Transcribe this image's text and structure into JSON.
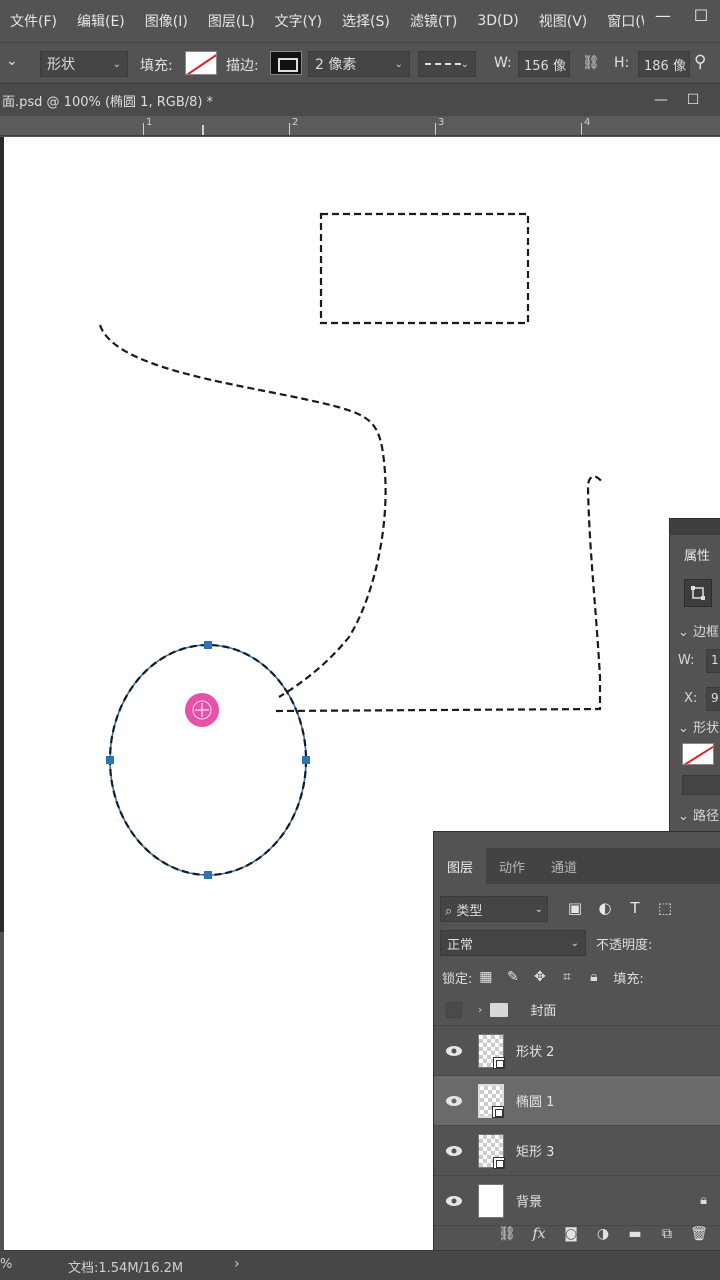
{
  "menubar": {
    "items": [
      "文件(F)",
      "编辑(E)",
      "图像(I)",
      "图层(L)",
      "文字(Y)",
      "选择(S)",
      "滤镜(T)",
      "3D(D)",
      "视图(V)",
      "窗口(W"
    ],
    "window_buttons": [
      "—",
      "☐"
    ]
  },
  "options": {
    "left_chevron": "⌄",
    "mode": "形状",
    "fill_label": "填充:",
    "stroke_label": "描边:",
    "stroke_width": "2 像素",
    "w_label": "W:",
    "w_value": "156 像",
    "h_label": "H:",
    "h_value": "186 像",
    "search_glyph": "⚲"
  },
  "document": {
    "tab_title": "面.psd @ 100% (椭圆 1, RGB/8) *",
    "buttons": [
      "—",
      "☐",
      "✕"
    ]
  },
  "ruler": {
    "labels": [
      "1",
      "2",
      "3",
      "4"
    ]
  },
  "properties": {
    "title": "属性",
    "section1": "边框",
    "w_label": "W:",
    "w_value": "1!",
    "x_label": "X:",
    "x_value": "9:",
    "section2": "形状",
    "section3": "路径"
  },
  "layers": {
    "tabs": [
      "图层",
      "动作",
      "通道"
    ],
    "filter_label": "⌕ 类型",
    "blend_mode": "正常",
    "opacity_label": "不透明度:",
    "lock_label": "锁定:",
    "fill_label": "填充:",
    "items": [
      {
        "name": "封面",
        "type": "group"
      },
      {
        "name": "形状 2",
        "type": "shape"
      },
      {
        "name": "椭圆 1",
        "type": "shape",
        "selected": true
      },
      {
        "name": "矩形 3",
        "type": "shape"
      },
      {
        "name": "背景",
        "type": "background",
        "locked": true
      }
    ]
  },
  "status": {
    "zoom": "%",
    "doc": "文档:1.54M/16.2M",
    "arrow": "›"
  },
  "colors": {
    "ui_bg": "#535353",
    "canvas": "#ffffff",
    "selection_handle": "#2e74b5",
    "cursor_pink": "#e33fa0"
  }
}
